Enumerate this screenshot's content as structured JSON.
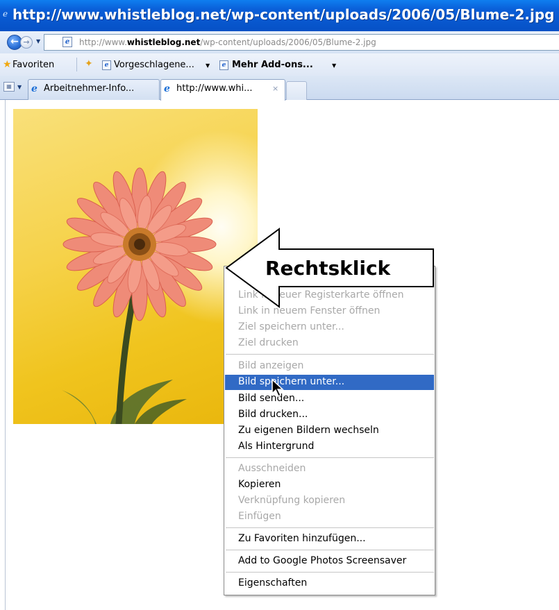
{
  "window": {
    "title": "http://www.whistleblog.net/wp-content/uploads/2006/05/Blume-2.jpg -"
  },
  "address_bar": {
    "url_prefix": "http://www.",
    "url_domain": "whistleblog.net",
    "url_path": "/wp-content/uploads/2006/05/Blume-2.jpg"
  },
  "favorites_bar": {
    "favorites_label": "Favoriten",
    "items": [
      {
        "label": "Vorgeschlagene...",
        "icon": "ie-page-icon"
      },
      {
        "label": "Mehr Add-ons...",
        "icon": "ie-page-icon"
      }
    ]
  },
  "tabs": [
    {
      "label": "Arbeitnehmer-Info...",
      "active": false
    },
    {
      "label": "http://www.whi...",
      "active": true,
      "close": "×"
    }
  ],
  "callout": {
    "text": "Rechtsklick"
  },
  "context_menu": {
    "groups": [
      [
        {
          "label": "Link in neuer Registerkarte öffnen",
          "enabled": false
        },
        {
          "label": "Link in neuem Fenster öffnen",
          "enabled": false
        },
        {
          "label": "Ziel speichern unter...",
          "enabled": false
        },
        {
          "label": "Ziel drucken",
          "enabled": false
        }
      ],
      [
        {
          "label": "Bild anzeigen",
          "enabled": false
        },
        {
          "label": "Bild speichern unter...",
          "enabled": true,
          "highlighted": true
        },
        {
          "label": "Bild senden...",
          "enabled": true
        },
        {
          "label": "Bild drucken...",
          "enabled": true
        },
        {
          "label": "Zu eigenen Bildern wechseln",
          "enabled": true
        },
        {
          "label": "Als Hintergrund",
          "enabled": true
        }
      ],
      [
        {
          "label": "Ausschneiden",
          "enabled": false
        },
        {
          "label": "Kopieren",
          "enabled": true
        },
        {
          "label": "Verknüpfung kopieren",
          "enabled": false
        },
        {
          "label": "Einfügen",
          "enabled": false
        }
      ],
      [
        {
          "label": "Zu Favoriten hinzufügen...",
          "enabled": true
        }
      ],
      [
        {
          "label": "Add to Google Photos Screensaver",
          "enabled": true
        }
      ],
      [
        {
          "label": "Eigenschaften",
          "enabled": true
        }
      ]
    ]
  },
  "colors": {
    "titlebar": "#0a5fd8",
    "menu_highlight": "#316ac5",
    "disabled_text": "#a8a8a8",
    "photo_background": "#f6d24a",
    "flower_petals": "#f08a78"
  }
}
